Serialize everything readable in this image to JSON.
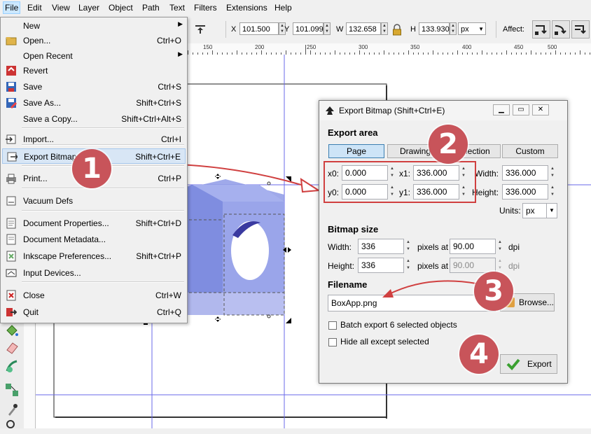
{
  "menubar": {
    "items": [
      "File",
      "Edit",
      "View",
      "Layer",
      "Object",
      "Path",
      "Text",
      "Filters",
      "Extensions",
      "Help"
    ]
  },
  "toolbar": {
    "x_label": "X",
    "x_value": "101.500",
    "y_label": "Y",
    "y_value": "101.099",
    "w_label": "W",
    "w_value": "132.658",
    "h_label": "H",
    "h_value": "133.930",
    "unit": "px",
    "affect_label": "Affect:"
  },
  "ruler": {
    "labels": [
      "150",
      "200",
      "250",
      "300",
      "350",
      "400",
      "450",
      "500"
    ]
  },
  "file_menu": {
    "items": [
      {
        "label": "New",
        "shortcut": "",
        "submenu": true,
        "icon": "none"
      },
      {
        "label": "Open...",
        "shortcut": "Ctrl+O",
        "icon": "folder-open-icon"
      },
      {
        "label": "Open Recent",
        "shortcut": "",
        "submenu": true,
        "icon": "none"
      },
      {
        "label": "Revert",
        "shortcut": "",
        "icon": "revert-icon"
      },
      {
        "label": "Save",
        "shortcut": "Ctrl+S",
        "icon": "save-icon"
      },
      {
        "label": "Save As...",
        "shortcut": "Shift+Ctrl+S",
        "icon": "save-as-icon"
      },
      {
        "label": "Save a Copy...",
        "shortcut": "Shift+Ctrl+Alt+S",
        "icon": "none"
      },
      {
        "label": "Import...",
        "shortcut": "Ctrl+I",
        "icon": "import-icon"
      },
      {
        "label": "Export Bitmap...",
        "shortcut": "Shift+Ctrl+E",
        "icon": "export-icon"
      },
      {
        "label": "Print...",
        "shortcut": "Ctrl+P",
        "icon": "print-icon"
      },
      {
        "label": "Vacuum Defs",
        "shortcut": "",
        "icon": "vacuum-icon"
      },
      {
        "label": "Document Properties...",
        "shortcut": "Shift+Ctrl+D",
        "icon": "document-properties-icon"
      },
      {
        "label": "Document Metadata...",
        "shortcut": "",
        "icon": "metadata-icon"
      },
      {
        "label": "Inkscape Preferences...",
        "shortcut": "Shift+Ctrl+P",
        "icon": "preferences-icon"
      },
      {
        "label": "Input Devices...",
        "shortcut": "",
        "icon": "input-devices-icon"
      },
      {
        "label": "Close",
        "shortcut": "Ctrl+W",
        "icon": "close-doc-icon"
      },
      {
        "label": "Quit",
        "shortcut": "Ctrl+Q",
        "icon": "quit-icon"
      }
    ]
  },
  "dialog": {
    "title": "Export Bitmap (Shift+Ctrl+E)",
    "export_area_heading": "Export area",
    "tabs": [
      "Page",
      "Drawing",
      "Selection",
      "Custom"
    ],
    "selected_tab": "Page",
    "x0_label": "x0:",
    "x0_value": "0.000",
    "x1_label": "x1:",
    "x1_value": "336.000",
    "y0_label": "y0:",
    "y0_value": "0.000",
    "y1_label": "y1:",
    "y1_value": "336.000",
    "width_label": "Width:",
    "width_value": "336.000",
    "height_label": "Height:",
    "height_value": "336.000",
    "units_label": "Units:",
    "units_value": "px",
    "bitmap_heading": "Bitmap size",
    "bmp_width_label": "Width:",
    "bmp_width_value": "336",
    "bmp_height_label": "Height:",
    "bmp_height_value": "336",
    "pixels_at_1": "pixels at",
    "dpi_1_value": "90.00",
    "dpi_1_label": "dpi",
    "pixels_at_2": "pixels at",
    "dpi_2_value": "90.00",
    "dpi_2_label": "dpi",
    "filename_heading": "Filename",
    "filename_value": "BoxApp.png",
    "browse_label": "Browse...",
    "batch_label": "Batch export 6 selected objects",
    "hide_label": "Hide all except selected",
    "export_label": "Export"
  },
  "annotations": {
    "badges": [
      "1",
      "2",
      "3",
      "4"
    ],
    "color": "#c8545a"
  },
  "colors": {
    "box_face": "#7d8be0",
    "box_top": "#9aa6ea",
    "highlight": "#d04040",
    "selected_tab": "#cde4f7"
  }
}
